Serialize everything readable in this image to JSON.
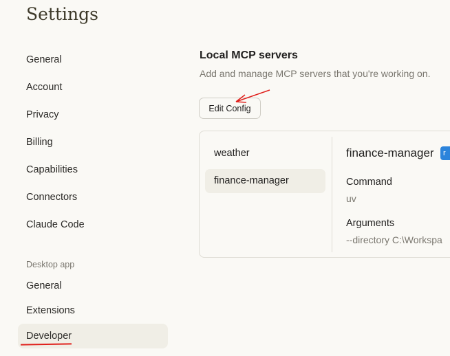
{
  "page_title": "Settings",
  "sidebar": {
    "items": [
      {
        "label": "General"
      },
      {
        "label": "Account"
      },
      {
        "label": "Privacy"
      },
      {
        "label": "Billing"
      },
      {
        "label": "Capabilities"
      },
      {
        "label": "Connectors"
      },
      {
        "label": "Claude Code"
      }
    ],
    "desktop_section": "Desktop app",
    "desktop_items": [
      {
        "label": "General"
      },
      {
        "label": "Extensions"
      },
      {
        "label": "Developer",
        "active": true
      }
    ]
  },
  "main": {
    "heading": "Local MCP servers",
    "subheading": "Add and manage MCP servers that you're working on.",
    "edit_config_label": "Edit Config",
    "servers": [
      {
        "label": "weather"
      },
      {
        "label": "finance-manager",
        "active": true
      }
    ],
    "detail": {
      "name": "finance-manager",
      "status_badge": "r",
      "badge_color": "#2c84db",
      "command_label": "Command",
      "command_value": "uv",
      "arguments_label": "Arguments",
      "arguments_value": "--directory C:\\Workspa"
    }
  },
  "annotation_color": "#e0201c"
}
